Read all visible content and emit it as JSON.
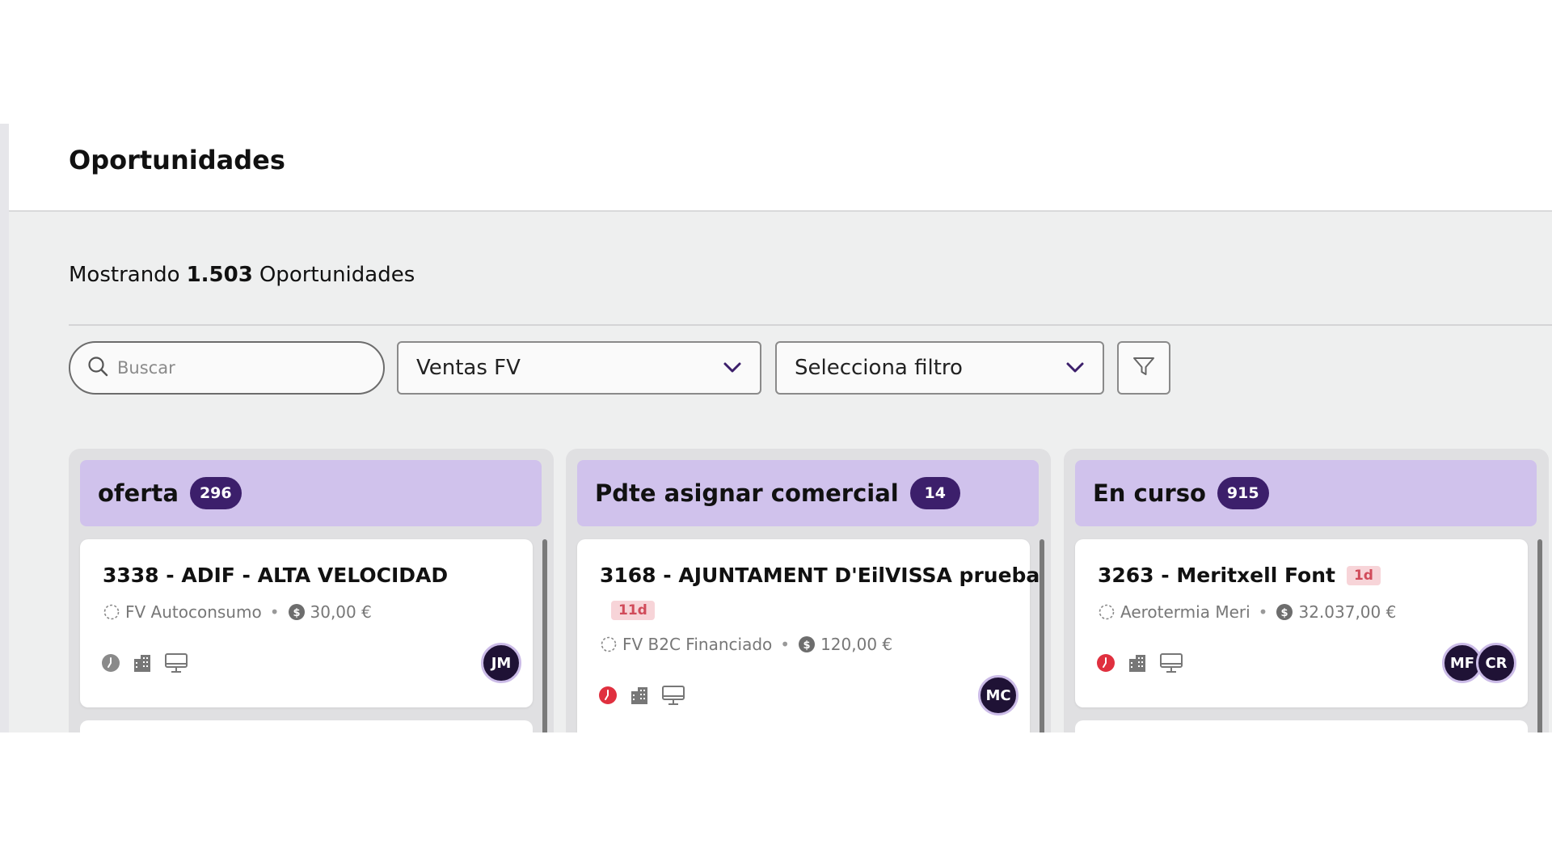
{
  "header": {
    "title": "Oportunidades"
  },
  "summary": {
    "prefix": "Mostrando",
    "count": "1.503",
    "suffix": "Oportunidades"
  },
  "toolbar": {
    "search_placeholder": "Buscar",
    "pipeline_select": "Ventas FV",
    "filter_select": "Selecciona filtro"
  },
  "colors": {
    "accent": "#3c1f6b",
    "column_header": "#d0c2ec",
    "overdue": "#e0303f"
  },
  "columns": [
    {
      "title": "oferta",
      "count": "296",
      "card": {
        "title": "3338 - ADIF - ALTA VELOCIDAD",
        "days_badge": "",
        "type": "FV Autoconsumo",
        "amount": "30,00 €",
        "clock": "grey",
        "avatars": [
          "JM"
        ]
      }
    },
    {
      "title": "Pdte asignar comercial",
      "count": "14",
      "card": {
        "title": "3168 - AJUNTAMENT D'EilVISSA prueba",
        "days_badge": "11d",
        "type": "FV B2C Financiado",
        "amount": "120,00 €",
        "clock": "red",
        "avatars": [
          "MC"
        ]
      }
    },
    {
      "title": "En curso",
      "count": "915",
      "card": {
        "title": "3263 - Meritxell Font",
        "days_badge": "1d",
        "type": "Aerotermia Meri",
        "amount": "32.037,00 €",
        "clock": "red",
        "avatars": [
          "MF",
          "CR"
        ]
      }
    }
  ]
}
